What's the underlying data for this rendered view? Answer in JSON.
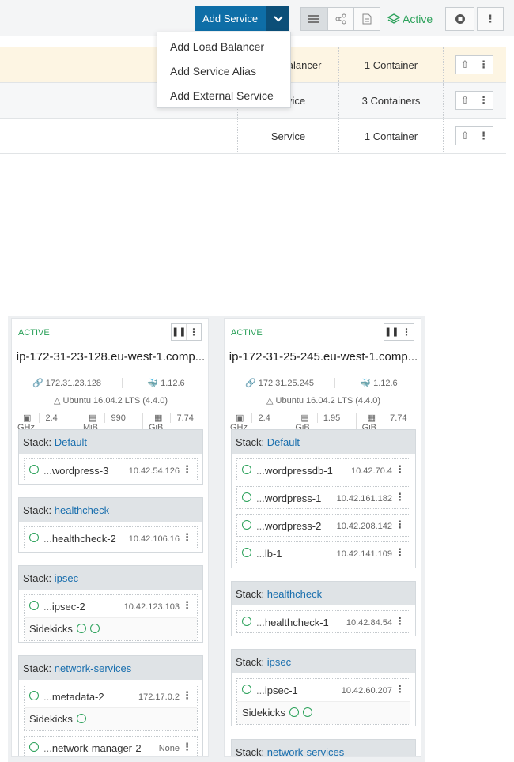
{
  "toolbar": {
    "add_service_label": "Add Service",
    "active_label": "Active",
    "icons": [
      "list-view-icon",
      "graph-view-icon",
      "compose-file-icon",
      "layers-icon",
      "stop-icon",
      "more-icon"
    ]
  },
  "dropdown": {
    "items": [
      "Add Load Balancer",
      "Add Service Alias",
      "Add External Service"
    ]
  },
  "service_rows": [
    {
      "type": "Load Balancer",
      "count": "1 Container"
    },
    {
      "type": "Service",
      "count": "3 Containers"
    },
    {
      "type": "Service",
      "count": "1 Container"
    }
  ],
  "hosts": [
    {
      "state": "ACTIVE",
      "name": "ip-172-31-23-128.eu-west-1.comp...",
      "ip": "172.31.23.128",
      "docker": "1.12.6",
      "os": "Ubuntu 16.04.2 LTS (4.4.0)",
      "cpu": "2.4 GHz",
      "memory": "990 MiB",
      "disk": "7.74 GiB",
      "stacks": [
        {
          "label": "Stack: ",
          "name": "Default",
          "containers": [
            {
              "name": "wordpress-3",
              "ip": "10.42.54.126"
            }
          ]
        },
        {
          "label": "Stack: ",
          "name": "healthcheck",
          "containers": [
            {
              "name": "healthcheck-2",
              "ip": "10.42.106.16"
            }
          ]
        },
        {
          "label": "Stack: ",
          "name": "ipsec",
          "containers": [
            {
              "name": "ipsec-2",
              "ip": "10.42.123.103"
            }
          ],
          "sidekicks_label": "Sidekicks"
        },
        {
          "label": "Stack: ",
          "name": "network-services",
          "containers": [
            {
              "name": "metadata-2",
              "ip": "172.17.0.2"
            },
            {
              "name": "network-manager-2",
              "ip": "None"
            }
          ],
          "sidekicks_label": "Sidekicks"
        }
      ]
    },
    {
      "state": "ACTIVE",
      "name": "ip-172-31-25-245.eu-west-1.comp...",
      "ip": "172.31.25.245",
      "docker": "1.12.6",
      "os": "Ubuntu 16.04.2 LTS (4.4.0)",
      "cpu": "2.4 GHz",
      "memory": "1.95 GiB",
      "disk": "7.74 GiB",
      "stacks": [
        {
          "label": "Stack: ",
          "name": "Default",
          "containers": [
            {
              "name": "wordpressdb-1",
              "ip": "10.42.70.4"
            },
            {
              "name": "wordpress-1",
              "ip": "10.42.161.182"
            },
            {
              "name": "wordpress-2",
              "ip": "10.42.208.142"
            },
            {
              "name": "lb-1",
              "ip": "10.42.141.109"
            }
          ]
        },
        {
          "label": "Stack: ",
          "name": "healthcheck",
          "containers": [
            {
              "name": "healthcheck-1",
              "ip": "10.42.84.54"
            }
          ]
        },
        {
          "label": "Stack: ",
          "name": "ipsec",
          "containers": [
            {
              "name": "ipsec-1",
              "ip": "10.42.60.207"
            }
          ],
          "sidekicks_label": "Sidekicks"
        },
        {
          "label": "Stack: ",
          "name": "network-services",
          "containers": []
        }
      ]
    }
  ],
  "colors": {
    "accent": "#0e6ea7",
    "active": "#2ba15a",
    "link": "#1a6fae"
  }
}
